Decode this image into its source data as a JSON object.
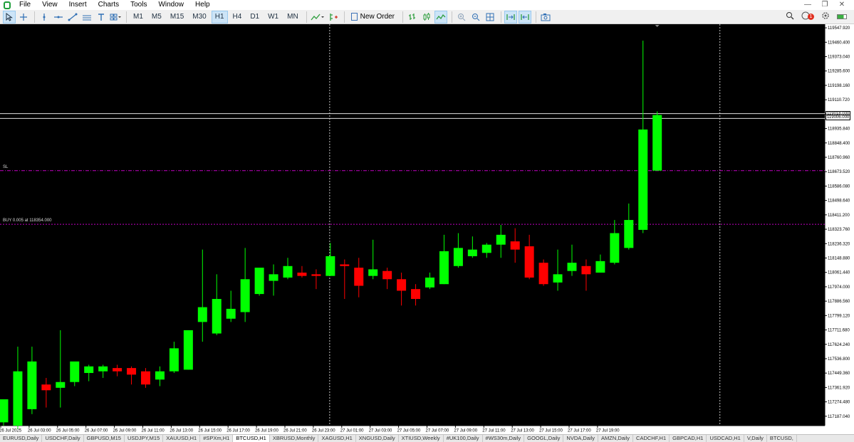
{
  "menu": [
    "File",
    "View",
    "Insert",
    "Charts",
    "Tools",
    "Window",
    "Help"
  ],
  "window_controls": [
    "—",
    "❐",
    "✕"
  ],
  "toolbar": {
    "timeframes": [
      "M1",
      "M5",
      "M15",
      "M30",
      "H1",
      "H4",
      "D1",
      "W1",
      "MN"
    ],
    "active_timeframe": "H1",
    "new_order": "New Order",
    "alert_count": "1"
  },
  "chart": {
    "sl_label": "SL",
    "position_label": "BUY 0.005 at 118354.000",
    "bid_tag": "119018.000",
    "ask_tag": "119006.000"
  },
  "tabs": [
    {
      "label": "EURUSD,Daily",
      "active": false
    },
    {
      "label": "USDCHF,Daily",
      "active": false
    },
    {
      "label": "GBPUSD,M15",
      "active": false
    },
    {
      "label": "USDJPY,M15",
      "active": false
    },
    {
      "label": "XAUUSD,H1",
      "active": false
    },
    {
      "label": "#SPXm,H1",
      "active": false
    },
    {
      "label": "BTCUSD,H1",
      "active": true
    },
    {
      "label": "XBRUSD,Monthly",
      "active": false
    },
    {
      "label": "XAGUSD,H1",
      "active": false
    },
    {
      "label": "XNGUSD,Daily",
      "active": false
    },
    {
      "label": "XTIUSD,Weekly",
      "active": false
    },
    {
      "label": "#UK100,Daily",
      "active": false
    },
    {
      "label": "#WS30m,Daily",
      "active": false
    },
    {
      "label": "GOOGL,Daily",
      "active": false
    },
    {
      "label": "NVDA,Daily",
      "active": false
    },
    {
      "label": "AMZN,Daily",
      "active": false
    },
    {
      "label": "CADCHF,H1",
      "active": false
    },
    {
      "label": "GBPCAD,H1",
      "active": false
    },
    {
      "label": "USDCAD,H1",
      "active": false
    },
    {
      "label": "V,Daily",
      "active": false
    },
    {
      "label": "BTCUSD,",
      "active": false
    }
  ],
  "chart_data": {
    "type": "candlestick",
    "symbol": "BTCUSD",
    "timeframe": "H1",
    "colors": {
      "background": "#000000",
      "bull": "#00ff00",
      "bear": "#ff0000",
      "axis_text": "#000000",
      "grid_marker": "#c0c0c0",
      "sl_line": "#c000c0",
      "position_line": "#c000c0"
    },
    "ylim": [
      117130,
      119570
    ],
    "y_ticks": [
      "119547.920",
      "119460.400",
      "119373.040",
      "119285.600",
      "119198.160",
      "119110.720",
      "119023.280",
      "118935.840",
      "118848.400",
      "118760.960",
      "118673.520",
      "118586.080",
      "118498.640",
      "118411.200",
      "118323.760",
      "118236.320",
      "118148.880",
      "118061.440",
      "117974.000",
      "117886.560",
      "117799.120",
      "117711.680",
      "117624.240",
      "117536.800",
      "117449.360",
      "117361.920",
      "117274.480",
      "117187.040"
    ],
    "x_ticks": [
      "26 Jul 2025",
      "26 Jul 03:00",
      "26 Jul 05:00",
      "26 Jul 07:00",
      "26 Jul 09:00",
      "26 Jul 11:00",
      "26 Jul 13:00",
      "26 Jul 15:00",
      "26 Jul 17:00",
      "26 Jul 19:00",
      "26 Jul 21:00",
      "26 Jul 23:00",
      "27 Jul 01:00",
      "27 Jul 03:00",
      "27 Jul 05:00",
      "27 Jul 07:00",
      "27 Jul 09:00",
      "27 Jul 11:00",
      "27 Jul 13:00",
      "27 Jul 15:00",
      "27 Jul 17:00",
      "27 Jul 19:00"
    ],
    "bid": 119018.0,
    "ask": 119006.0,
    "sl": 118680.0,
    "position_price": 118354.0,
    "session_separators": [
      "26 Jul 23:00",
      "27 Jul 23:00"
    ],
    "candles": [
      {
        "o": 117150,
        "h": 117270,
        "l": 117130,
        "c": 117290
      },
      {
        "o": 117130,
        "h": 117610,
        "l": 117110,
        "c": 117460
      },
      {
        "o": 117230,
        "h": 117610,
        "l": 117200,
        "c": 117520
      },
      {
        "o": 117380,
        "h": 117420,
        "l": 117240,
        "c": 117345
      },
      {
        "o": 117360,
        "h": 117710,
        "l": 117240,
        "c": 117395
      },
      {
        "o": 117395,
        "h": 117470,
        "l": 117370,
        "c": 117520
      },
      {
        "o": 117450,
        "h": 117500,
        "l": 117400,
        "c": 117490
      },
      {
        "o": 117460,
        "h": 117500,
        "l": 117420,
        "c": 117490
      },
      {
        "o": 117480,
        "h": 117500,
        "l": 117430,
        "c": 117460
      },
      {
        "o": 117480,
        "h": 117490,
        "l": 117380,
        "c": 117440
      },
      {
        "o": 117460,
        "h": 117480,
        "l": 117360,
        "c": 117380
      },
      {
        "o": 117410,
        "h": 117490,
        "l": 117370,
        "c": 117460
      },
      {
        "o": 117460,
        "h": 117640,
        "l": 117450,
        "c": 117600
      },
      {
        "o": 117470,
        "h": 117660,
        "l": 117470,
        "c": 117710
      },
      {
        "o": 117760,
        "h": 118200,
        "l": 117640,
        "c": 117850
      },
      {
        "o": 117690,
        "h": 118050,
        "l": 117680,
        "c": 117900
      },
      {
        "o": 117780,
        "h": 117950,
        "l": 117760,
        "c": 117840
      },
      {
        "o": 117820,
        "h": 118210,
        "l": 117760,
        "c": 118020
      },
      {
        "o": 117930,
        "h": 118080,
        "l": 117920,
        "c": 118090
      },
      {
        "o": 118010,
        "h": 118110,
        "l": 117920,
        "c": 118050
      },
      {
        "o": 118030,
        "h": 118150,
        "l": 118020,
        "c": 118100
      },
      {
        "o": 118060,
        "h": 118100,
        "l": 118030,
        "c": 118040
      },
      {
        "o": 118050,
        "h": 118080,
        "l": 117960,
        "c": 118040
      },
      {
        "o": 118040,
        "h": 118240,
        "l": 118040,
        "c": 118160
      },
      {
        "o": 118110,
        "h": 118140,
        "l": 117900,
        "c": 118100
      },
      {
        "o": 118090,
        "h": 118150,
        "l": 117910,
        "c": 117980
      },
      {
        "o": 118040,
        "h": 118260,
        "l": 118020,
        "c": 118080
      },
      {
        "o": 118070,
        "h": 118090,
        "l": 117960,
        "c": 118020
      },
      {
        "o": 118020,
        "h": 118060,
        "l": 117860,
        "c": 117950
      },
      {
        "o": 117960,
        "h": 117990,
        "l": 117860,
        "c": 117900
      },
      {
        "o": 117970,
        "h": 118060,
        "l": 117960,
        "c": 118030
      },
      {
        "o": 117990,
        "h": 118290,
        "l": 117990,
        "c": 118190
      },
      {
        "o": 118100,
        "h": 118300,
        "l": 118090,
        "c": 118210
      },
      {
        "o": 118160,
        "h": 118280,
        "l": 118150,
        "c": 118200
      },
      {
        "o": 118180,
        "h": 118240,
        "l": 118150,
        "c": 118230
      },
      {
        "o": 118230,
        "h": 118350,
        "l": 118150,
        "c": 118290
      },
      {
        "o": 118250,
        "h": 118330,
        "l": 118120,
        "c": 118200
      },
      {
        "o": 118220,
        "h": 118290,
        "l": 118020,
        "c": 118030
      },
      {
        "o": 118120,
        "h": 118140,
        "l": 117980,
        "c": 117990
      },
      {
        "o": 118000,
        "h": 118200,
        "l": 117950,
        "c": 118050
      },
      {
        "o": 118070,
        "h": 118230,
        "l": 118040,
        "c": 118120
      },
      {
        "o": 118100,
        "h": 118140,
        "l": 117950,
        "c": 118050
      },
      {
        "o": 118060,
        "h": 118170,
        "l": 118060,
        "c": 118130
      },
      {
        "o": 118120,
        "h": 118380,
        "l": 118110,
        "c": 118300
      },
      {
        "o": 118210,
        "h": 118480,
        "l": 118200,
        "c": 118380
      },
      {
        "o": 118320,
        "h": 119470,
        "l": 118300,
        "c": 118930
      },
      {
        "o": 118680,
        "h": 119040,
        "l": 118680,
        "c": 119018
      }
    ]
  }
}
